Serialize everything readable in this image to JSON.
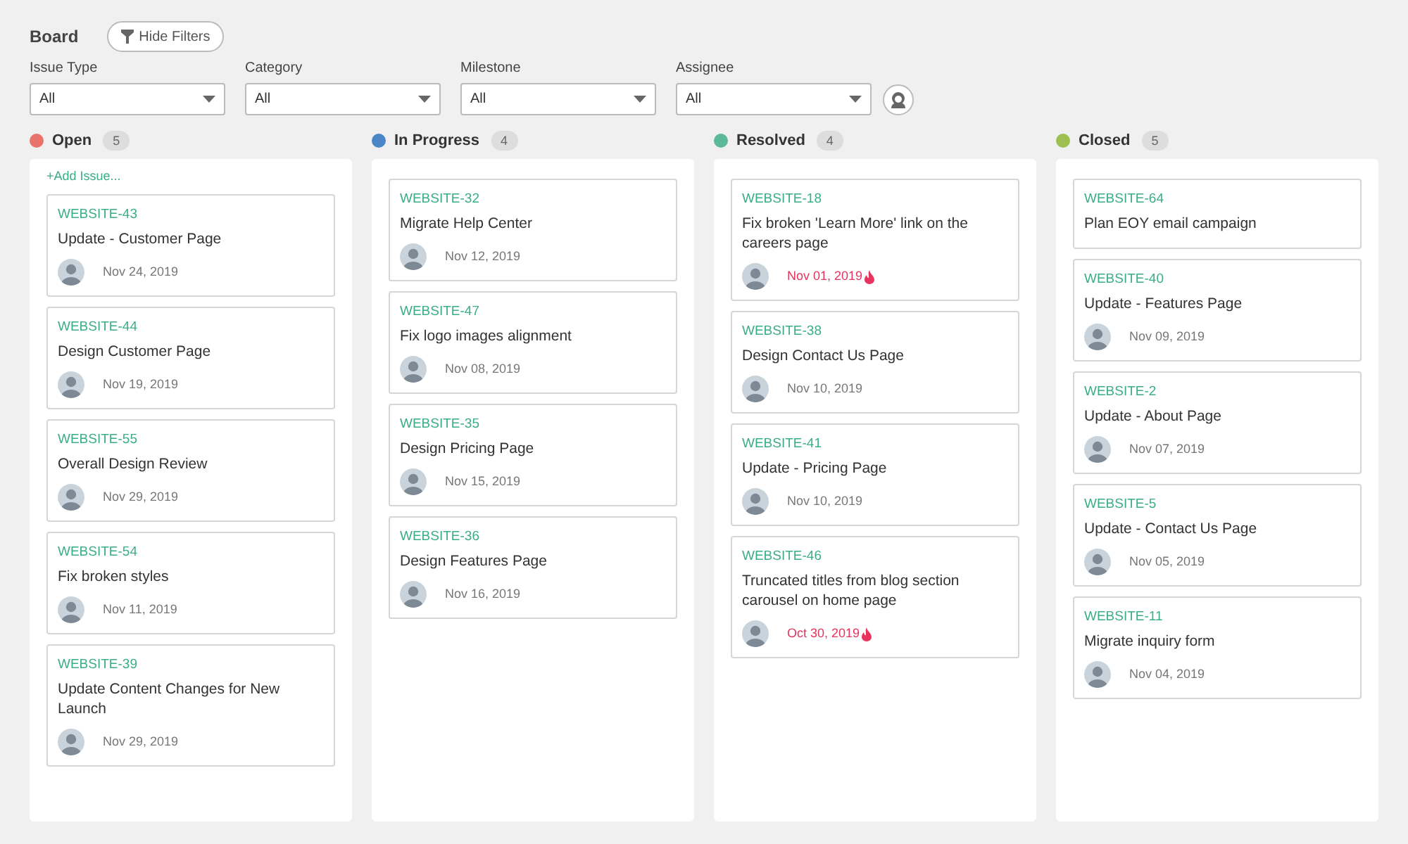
{
  "header": {
    "title": "Board",
    "hide_filters_button": "Hide Filters"
  },
  "filters": [
    {
      "label": "Issue Type",
      "value": "All"
    },
    {
      "label": "Category",
      "value": "All"
    },
    {
      "label": "Milestone",
      "value": "All"
    },
    {
      "label": "Assignee",
      "value": "All"
    }
  ],
  "columns": [
    {
      "name": "Open",
      "color": "#e8736b",
      "count": "5",
      "add_link": "+Add Issue...",
      "cards": [
        {
          "id": "WEBSITE-43",
          "title": "Update - Customer Page",
          "date": "Nov 24, 2019",
          "has_assignee": true,
          "overdue": false
        },
        {
          "id": "WEBSITE-44",
          "title": "Design Customer Page",
          "date": "Nov 19, 2019",
          "has_assignee": true,
          "overdue": false
        },
        {
          "id": "WEBSITE-55",
          "title": "Overall Design Review",
          "date": "Nov 29, 2019",
          "has_assignee": true,
          "overdue": false
        },
        {
          "id": "WEBSITE-54",
          "title": "Fix broken styles",
          "date": "Nov 11, 2019",
          "has_assignee": true,
          "overdue": false
        },
        {
          "id": "WEBSITE-39",
          "title": "Update Content Changes for New Launch",
          "date": "Nov 29, 2019",
          "has_assignee": true,
          "overdue": false
        }
      ]
    },
    {
      "name": "In Progress",
      "color": "#4a86c5",
      "count": "4",
      "cards": [
        {
          "id": "WEBSITE-32",
          "title": "Migrate Help Center",
          "date": "Nov 12, 2019",
          "has_assignee": true,
          "overdue": false
        },
        {
          "id": "WEBSITE-47",
          "title": "Fix logo images alignment",
          "date": "Nov 08, 2019",
          "has_assignee": true,
          "overdue": false
        },
        {
          "id": "WEBSITE-35",
          "title": "Design Pricing Page",
          "date": "Nov 15, 2019",
          "has_assignee": true,
          "overdue": false
        },
        {
          "id": "WEBSITE-36",
          "title": "Design Features Page",
          "date": "Nov 16, 2019",
          "has_assignee": true,
          "overdue": false
        }
      ]
    },
    {
      "name": "Resolved",
      "color": "#5cb89a",
      "count": "4",
      "cards": [
        {
          "id": "WEBSITE-18",
          "title": "Fix broken 'Learn More' link on the careers page",
          "date": "Nov 01, 2019",
          "has_assignee": true,
          "overdue": true
        },
        {
          "id": "WEBSITE-38",
          "title": "Design Contact Us Page",
          "date": "Nov 10, 2019",
          "has_assignee": true,
          "overdue": false
        },
        {
          "id": "WEBSITE-41",
          "title": "Update - Pricing Page",
          "date": "Nov 10, 2019",
          "has_assignee": true,
          "overdue": false
        },
        {
          "id": "WEBSITE-46",
          "title": "Truncated titles from blog section carousel on home page",
          "date": "Oct 30, 2019",
          "has_assignee": true,
          "overdue": true
        }
      ]
    },
    {
      "name": "Closed",
      "color": "#9bc050",
      "count": "5",
      "cards": [
        {
          "id": "WEBSITE-64",
          "title": "Plan EOY email campaign",
          "has_assignee": false
        },
        {
          "id": "WEBSITE-40",
          "title": "Update - Features Page",
          "date": "Nov 09, 2019",
          "has_assignee": true,
          "overdue": false
        },
        {
          "id": "WEBSITE-2",
          "title": "Update - About Page",
          "date": "Nov 07, 2019",
          "has_assignee": true,
          "overdue": false
        },
        {
          "id": "WEBSITE-5",
          "title": "Update - Contact Us Page",
          "date": "Nov 05, 2019",
          "has_assignee": true,
          "overdue": false
        },
        {
          "id": "WEBSITE-11",
          "title": "Migrate inquiry form",
          "date": "Nov 04, 2019",
          "has_assignee": true,
          "overdue": false
        }
      ]
    }
  ]
}
